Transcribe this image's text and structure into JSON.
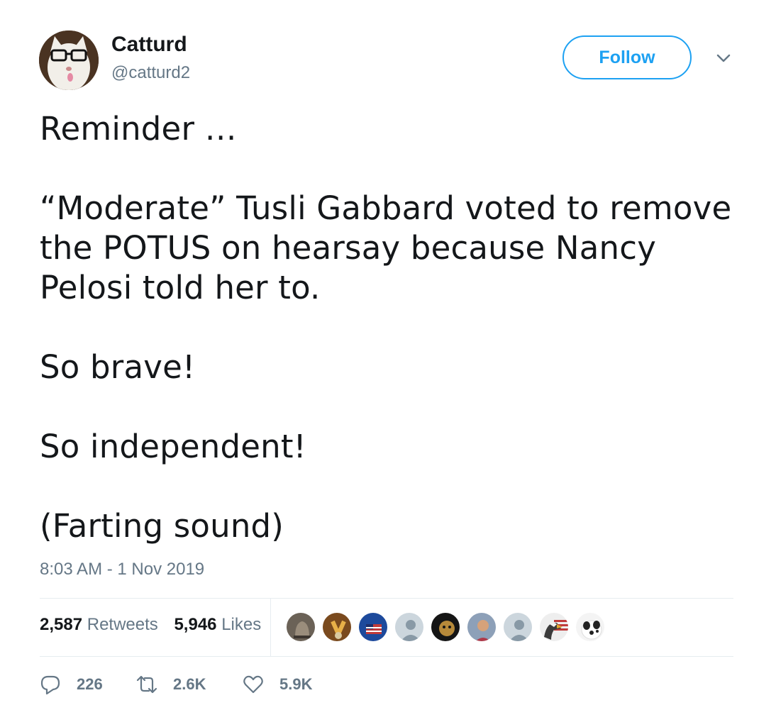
{
  "author": {
    "display_name": "Catturd",
    "handle": "@catturd2"
  },
  "follow_label": "Follow",
  "tweet": {
    "paragraphs": [
      "Reminder …",
      "“Moderate” Tusli Gabbard voted to remove the POTUS on hearsay because Nancy Pelosi told her to.",
      "So brave!",
      "So independent!",
      "(Farting sound)"
    ],
    "timestamp": "8:03 AM - 1 Nov 2019"
  },
  "stats": {
    "retweets_count": "2,587",
    "retweets_label": "Retweets",
    "likes_count": "5,946",
    "likes_label": "Likes"
  },
  "actions": {
    "replies": "226",
    "retweets": "2.6K",
    "likes": "5.9K"
  },
  "colors": {
    "accent": "#1da1f2",
    "secondary_text": "#657786",
    "primary_text": "#14171a",
    "divider": "#e6ecf0"
  },
  "icons": [
    "chevron-down-icon",
    "reply-icon",
    "retweet-icon",
    "heart-icon"
  ]
}
